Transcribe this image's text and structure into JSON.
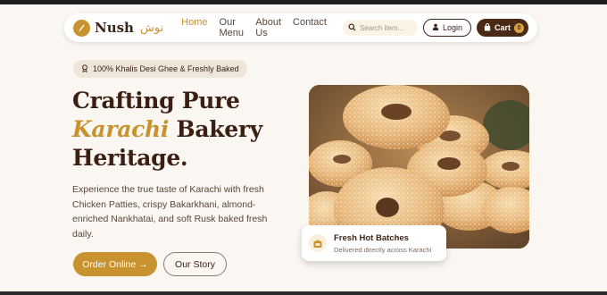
{
  "brand": {
    "name": "Nush",
    "urdu": "نوش",
    "logo_icon": "wheat-icon"
  },
  "nav": {
    "items": [
      {
        "label": "Home",
        "active": true
      },
      {
        "label": "Our Menu",
        "active": false
      },
      {
        "label": "About Us",
        "active": false
      },
      {
        "label": "Contact",
        "active": false
      }
    ]
  },
  "search": {
    "placeholder": "Search item...",
    "value": "",
    "icon": "search-icon"
  },
  "login": {
    "label": "Login",
    "icon": "user-icon"
  },
  "cart": {
    "label": "Cart",
    "count": "0",
    "icon": "bag-icon"
  },
  "hero": {
    "badge": "100% Khalis Desi Ghee & Freshly Baked",
    "badge_icon": "award-icon",
    "title_line1": "Crafting Pure",
    "title_accent": "Karachi",
    "title_line2_rest": " Bakery",
    "title_line3": "Heritage.",
    "description": "Experience the true taste of Karachi with fresh Chicken Patties, crispy Bakarkhani, almond-enriched Nankhatai, and soft Rusk baked fresh daily.",
    "primary_cta": "Order Online →",
    "secondary_cta": "Our Story"
  },
  "fresh_card": {
    "title": "Fresh Hot Batches",
    "subtitle": "Delivered directly across Karachi",
    "icon": "oven-icon"
  },
  "colors": {
    "accent": "#c8922e",
    "dark_brown": "#4a2a14",
    "background": "#faf6f1"
  }
}
